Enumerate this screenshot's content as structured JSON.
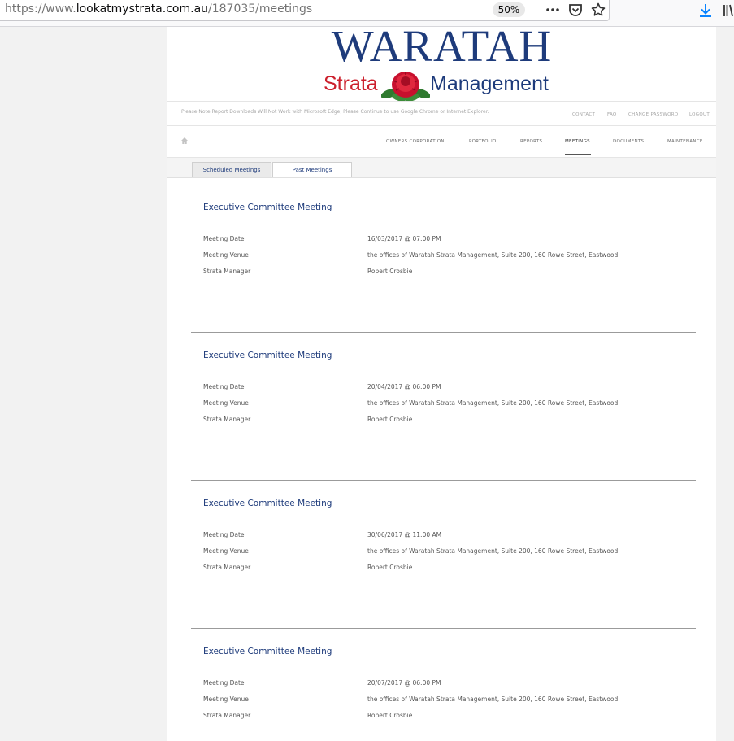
{
  "browser": {
    "url_prefix": "https://www.",
    "url_host": "lookatmystrata.com.au",
    "url_path": "/187035/meetings",
    "zoom": "50%"
  },
  "logo": {
    "title": "WARATAH",
    "word_left": "Strata",
    "word_right": "Management",
    "colors": {
      "navy": "#1e3b7b",
      "red": "#cc1f2c"
    }
  },
  "notice": "Please Note Report Downloads Will Not Work with Microsoft Edge, Please Continue to use Google Chrome or Internet Explorer.",
  "toplinks": [
    "CONTACT",
    "FAQ",
    "CHANGE PASSWORD",
    "LOGOUT"
  ],
  "nav": {
    "items": [
      "OWNERS CORPORATION",
      "PORTFOLIO",
      "REPORTS",
      "MEETINGS",
      "DOCUMENTS",
      "MAINTENANCE"
    ],
    "active": "MEETINGS"
  },
  "tabs": [
    {
      "label": "Scheduled Meetings",
      "active": true
    },
    {
      "label": "Past Meetings",
      "active": false
    }
  ],
  "meetings": [
    {
      "title": "Executive Committee Meeting",
      "date_label": "Meeting Date",
      "date": "16/03/2017 @ 07:00 PM",
      "venue_label": "Meeting Venue",
      "venue": "the offices of Waratah Strata Management, Suite 200, 160 Rowe Street, Eastwood",
      "manager_label": "Strata Manager",
      "manager": "Robert Crosbie"
    },
    {
      "title": "Executive Committee Meeting",
      "date_label": "Meeting Date",
      "date": "20/04/2017 @ 06:00 PM",
      "venue_label": "Meeting Venue",
      "venue": "the offices of Waratah Strata Management, Suite 200, 160 Rowe Street, Eastwood",
      "manager_label": "Strata Manager",
      "manager": "Robert Crosbie"
    },
    {
      "title": "Executive Committee Meeting",
      "date_label": "Meeting Date",
      "date": "30/06/2017 @ 11:00 AM",
      "venue_label": "Meeting Venue",
      "venue": "the offices of Waratah Strata Management, Suite 200, 160 Rowe Street, Eastwood",
      "manager_label": "Strata Manager",
      "manager": "Robert Crosbie"
    },
    {
      "title": "Executive Committee Meeting",
      "date_label": "Meeting Date",
      "date": "20/07/2017 @ 06:00 PM",
      "venue_label": "Meeting Venue",
      "venue": "the offices of Waratah Strata Management, Suite 200, 160 Rowe Street, Eastwood",
      "manager_label": "Strata Manager",
      "manager": "Robert Crosbie"
    }
  ]
}
